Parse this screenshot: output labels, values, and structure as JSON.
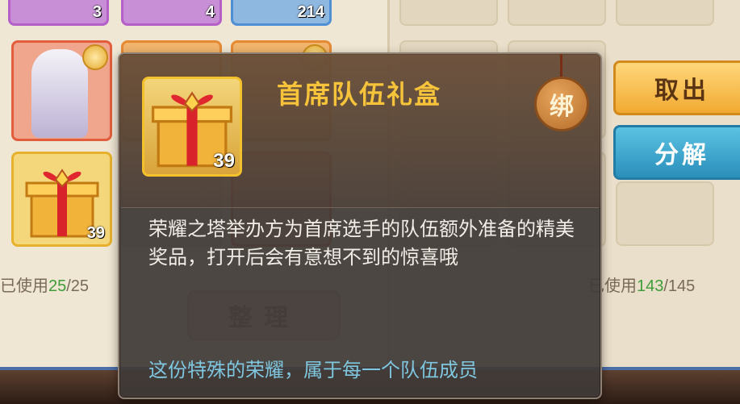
{
  "inventory_left": {
    "slot_counts": [
      "3",
      "4",
      "214"
    ],
    "gift_count": "39",
    "usage_label": "已使用",
    "usage_used": "25",
    "usage_total": "/25",
    "sort_button": "整理"
  },
  "inventory_right": {
    "usage_label": "已使用",
    "usage_used": "143",
    "usage_total": "/145",
    "take_out_button": "取出",
    "decompose_button": "分解"
  },
  "tooltip": {
    "item_name": "首席队伍礼盒",
    "item_count": "39",
    "bound_badge": "绑",
    "description": "荣耀之塔举办方为首席选手的队伍额外准备的精美奖品，打开后会有意想不到的惊喜哦",
    "flavor_text": "这份特殊的荣耀，属于每一个队伍成员"
  },
  "colors": {
    "title_gold": "#f6c33a",
    "flavor_blue": "#7fc6df",
    "used_green": "#3f9c3a"
  }
}
